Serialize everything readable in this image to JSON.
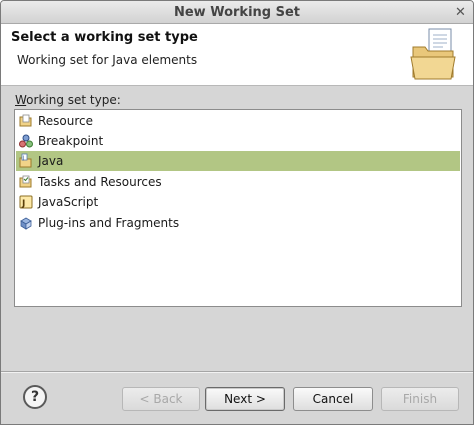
{
  "window": {
    "title": "New Working Set",
    "close_glyph": "✕"
  },
  "header": {
    "title": "Select a working set type",
    "description": "Working set for Java elements",
    "icon": "folder-document-icon"
  },
  "working_set": {
    "label_mnemonic": "W",
    "label_rest": "orking set type:",
    "items": [
      {
        "label": "Resource",
        "icon": "resource-icon",
        "selected": false
      },
      {
        "label": "Breakpoint",
        "icon": "breakpoint-icon",
        "selected": false
      },
      {
        "label": "Java",
        "icon": "java-icon",
        "selected": true
      },
      {
        "label": "Tasks and Resources",
        "icon": "tasks-icon",
        "selected": false
      },
      {
        "label": "JavaScript",
        "icon": "javascript-icon",
        "selected": false
      },
      {
        "label": "Plug-ins and Fragments",
        "icon": "plugin-icon",
        "selected": false
      }
    ]
  },
  "buttons": {
    "help_glyph": "?",
    "back": "< Back",
    "next": "Next >",
    "cancel": "Cancel",
    "finish": "Finish"
  },
  "colors": {
    "selection": "#b2c684"
  }
}
